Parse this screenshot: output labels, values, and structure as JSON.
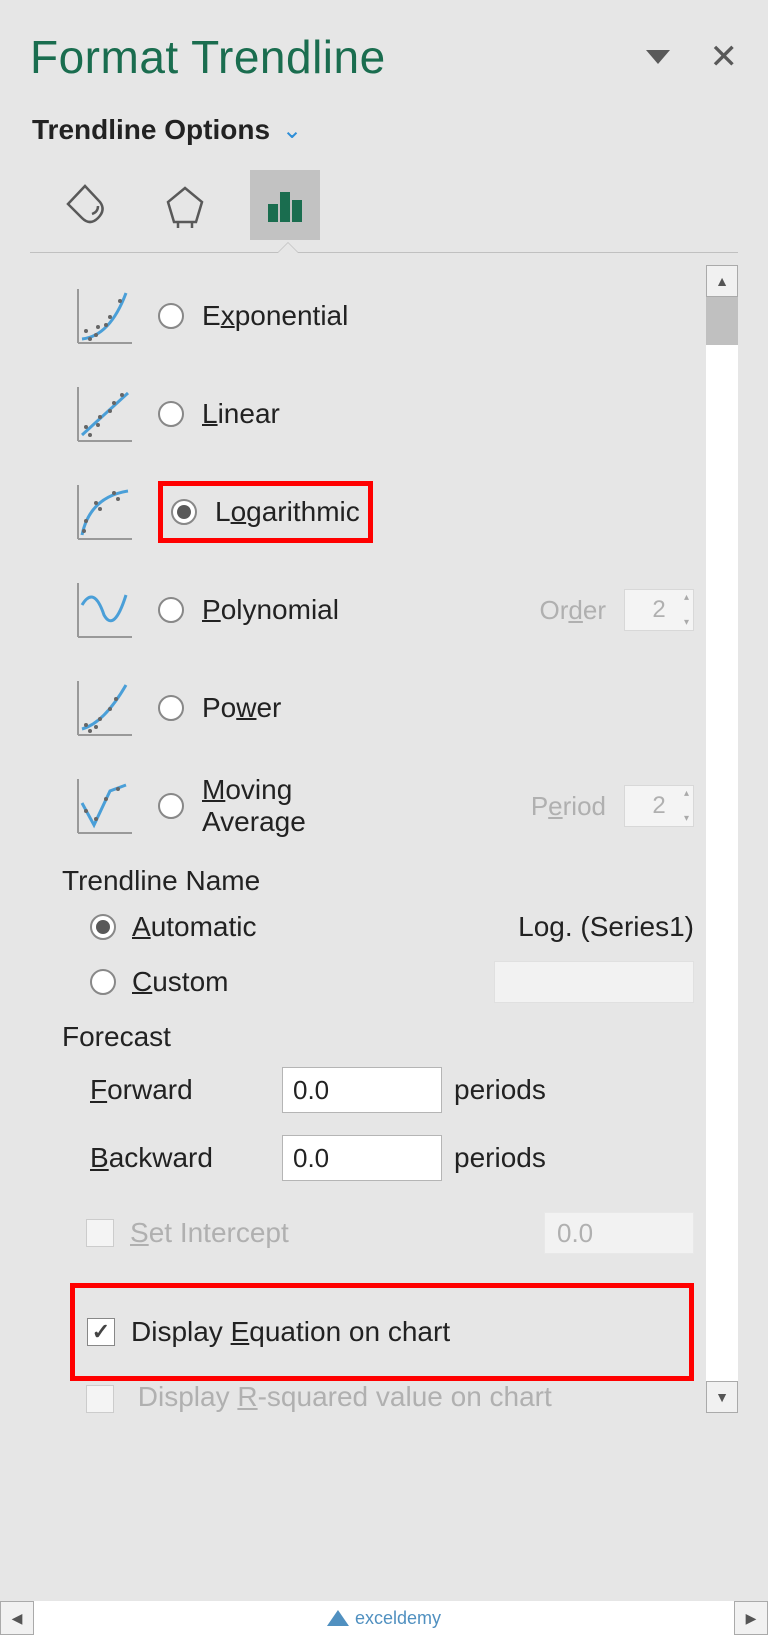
{
  "header": {
    "title": "Format Trendline"
  },
  "dropdown": {
    "label": "Trendline Options"
  },
  "trendline_types": {
    "exponential": "Exponential",
    "linear": "Linear",
    "logarithmic": "Logarithmic",
    "polynomial": "Polynomial",
    "power": "Power",
    "moving_average_1": "Moving",
    "moving_average_2": "Average",
    "poly_order_label": "Order",
    "poly_order_value": "2",
    "ma_period_label": "Period",
    "ma_period_value": "2"
  },
  "trendline_name": {
    "section": "Trendline Name",
    "automatic": "Automatic",
    "automatic_value": "Log. (Series1)",
    "custom": "Custom"
  },
  "forecast": {
    "section": "Forecast",
    "forward_label": "Forward",
    "forward_value": "0.0",
    "backward_label": "Backward",
    "backward_value": "0.0",
    "unit": "periods"
  },
  "options": {
    "set_intercept": "Set Intercept",
    "set_intercept_value": "0.0",
    "display_equation": "Display Equation on chart",
    "display_r2": "Display R-squared value on chart"
  },
  "watermark": "exceldemy"
}
